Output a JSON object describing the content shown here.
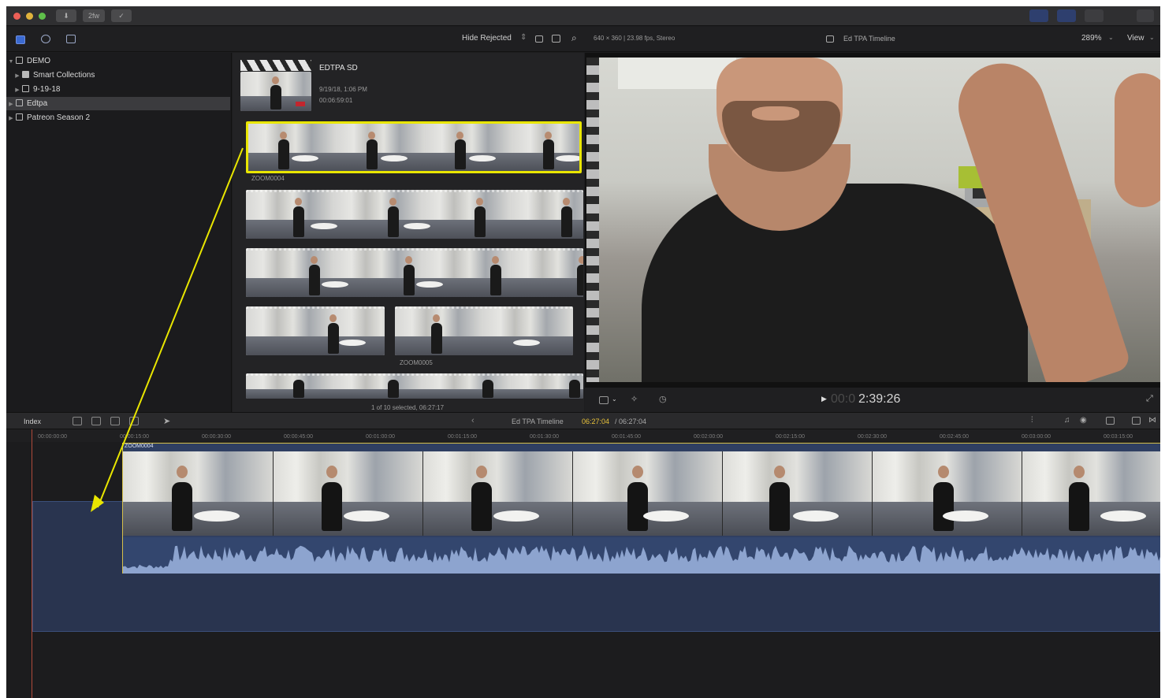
{
  "toolbar": {
    "layout_label": "2fw",
    "hide_rejected": "Hide Rejected",
    "format_info": "640 × 360 | 23.98 fps, Stereo",
    "viewer_title": "Ed TPA Timeline",
    "zoom": "289%",
    "view_label": "View"
  },
  "sidebar": {
    "items": [
      {
        "label": "DEMO"
      },
      {
        "label": "Smart Collections"
      },
      {
        "label": "9-19-18"
      },
      {
        "label": "Edtpa"
      },
      {
        "label": "Patreon Season 2"
      }
    ]
  },
  "browser": {
    "event_title": "EDTPA SD",
    "event_date": "9/19/18, 1:06 PM",
    "event_duration": "00:06:59:01",
    "clip1_name": "ZOOM0004",
    "clip2_name": "ZOOM0005",
    "selection_status": "1 of 10 selected, 06:27:17"
  },
  "viewer": {
    "timecode_dim": "00:0",
    "timecode": "2:39:26"
  },
  "timeline": {
    "index_label": "Index",
    "timeline_name": "Ed TPA Timeline",
    "position": "06:27:04",
    "duration": "/ 06:27:04",
    "clip_label": "ZOOM0004",
    "ruler": [
      "00:00:00:00",
      "00:00:15:00",
      "00:00:30:00",
      "00:00:45:00",
      "00:01:00:00",
      "00:01:15:00",
      "00:01:30:00",
      "00:01:45:00",
      "00:02:00:00",
      "00:02:15:00",
      "00:02:30:00",
      "00:02:45:00",
      "00:03:00:00",
      "00:03:15:00"
    ]
  },
  "colors": {
    "selection": "#e9e600",
    "clip_border": "#d6c04a",
    "storyline": "#29344f",
    "timecode_yellow": "#e8c23a"
  }
}
